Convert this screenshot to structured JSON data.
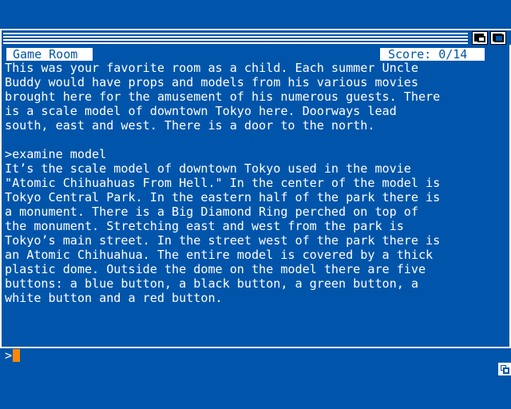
{
  "status_bar": {
    "location": "Game Room",
    "score": "Score: 0/14"
  },
  "story": {
    "lines": [
      "This was your favorite room as a child. Each summer Uncle",
      "Buddy would have props and models from his various movies",
      "brought here for the amusement of his numerous guests. There",
      "is a scale model of downtown Tokyo here. Doorways lead",
      "south, east and west. There is a door to the north.",
      "",
      ">examine model",
      "It’s the scale model of downtown Tokyo used in the movie",
      "\"Atomic Chihuahuas From Hell.\" In the center of the model is",
      "Tokyo Central Park. In the eastern half of the park there is",
      "a monument. There is a Big Diamond Ring perched on top of",
      "the monument. Stretching east and west from the park is",
      "Tokyo’s main street. In the street west of the park there is",
      "an Atomic Chihuahua. The entire model is covered by a thick",
      "plastic dome. Outside the dome on the model there are five",
      "buttons: a blue button, a black button, a green button, a",
      "white button and a red button."
    ]
  },
  "input": {
    "prompt": ">",
    "value": ""
  },
  "icons": {
    "depth_back": "depth-back-icon",
    "depth_front": "depth-front-icon",
    "resize": "resize-icon"
  },
  "colors": {
    "background": "#0055aa",
    "text": "#ffffff",
    "cursor": "#ff8800"
  }
}
